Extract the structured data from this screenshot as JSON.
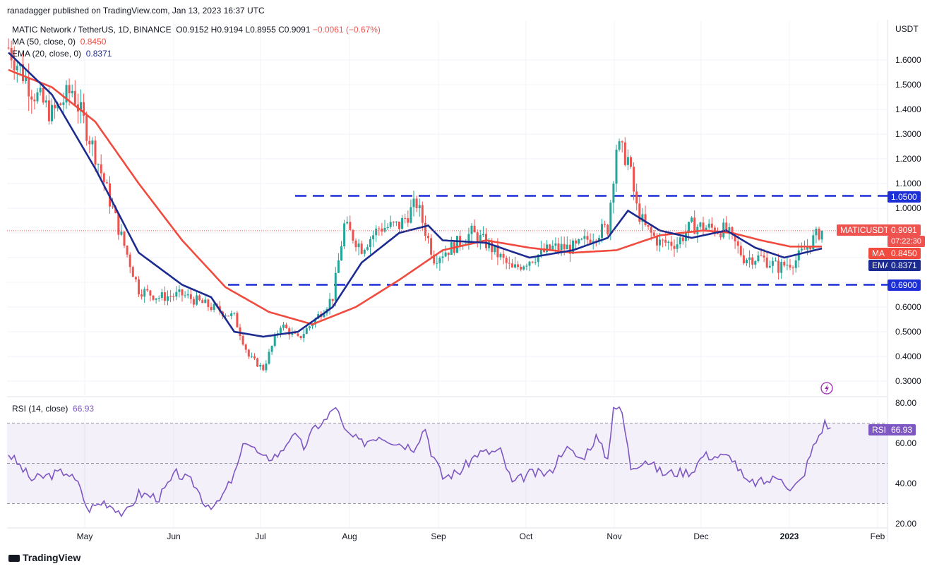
{
  "header": {
    "published_by": "ranadagger published on TradingView.com, Jan 13, 2023 16:37 UTC"
  },
  "legend": {
    "symbol": "MATIC Network / TetherUS, 1D, BINANCE",
    "o_label": "O",
    "o": "0.9152",
    "h_label": "H",
    "h": "0.9194",
    "l_label": "L",
    "l": "0.8955",
    "c_label": "C",
    "c": "0.9091",
    "change": "−0.0061 (−0.67%)",
    "ma_label": "MA (50, close, 0)",
    "ma_value": "0.8450",
    "ema_label": "EMA (20, close, 0)",
    "ema_value": "0.8371",
    "rsi_label": "RSI (14, close)",
    "rsi_value": "66.93"
  },
  "price_tags": {
    "resistance": "1.0500",
    "symbol_tag": "MATICUSDT",
    "last_price": "0.9091",
    "countdown": "07:22:30",
    "ma_tag": "MA",
    "ma_value": "0.8450",
    "ema_tag": "EMA",
    "ema_value": "0.8371",
    "support": "0.6900",
    "rsi_tag": "RSI",
    "rsi_value": "66.93"
  },
  "footer": {
    "brand": "TradingView"
  },
  "colors": {
    "candle_up": "#26a69a",
    "candle_down": "#ef5350",
    "ma": "#f04b3e",
    "ema": "#1c2b8f",
    "rsi": "#7e57c2",
    "hline": "#1c2fd6",
    "grid": "#f0f3fa"
  },
  "chart_data": [
    {
      "type": "candlestick",
      "currency": "USDT",
      "y_ticks": [
        "1.6000",
        "1.5000",
        "1.4000",
        "1.3000",
        "1.2000",
        "1.1000",
        "1.0000",
        "0.6000",
        "0.5000",
        "0.4000",
        "0.3000"
      ],
      "ylim": [
        0.27,
        1.72
      ],
      "x_tick_labels": [
        "May",
        "Jun",
        "Jul",
        "Aug",
        "Sep",
        "Oct",
        "Nov",
        "Dec",
        "2023",
        "Feb"
      ],
      "horizontal_levels": [
        1.05,
        0.69
      ],
      "anchors": [
        {
          "d": 0,
          "v": 1.65
        },
        {
          "d": 8,
          "v": 1.48
        },
        {
          "d": 15,
          "v": 1.38
        },
        {
          "d": 22,
          "v": 1.48
        },
        {
          "d": 30,
          "v": 1.22
        },
        {
          "d": 38,
          "v": 0.92
        },
        {
          "d": 45,
          "v": 0.67
        },
        {
          "d": 52,
          "v": 0.64
        },
        {
          "d": 60,
          "v": 0.65
        },
        {
          "d": 70,
          "v": 0.6
        },
        {
          "d": 78,
          "v": 0.56
        },
        {
          "d": 83,
          "v": 0.4
        },
        {
          "d": 88,
          "v": 0.35
        },
        {
          "d": 94,
          "v": 0.53
        },
        {
          "d": 100,
          "v": 0.47
        },
        {
          "d": 106,
          "v": 0.55
        },
        {
          "d": 112,
          "v": 0.64
        },
        {
          "d": 116,
          "v": 0.93
        },
        {
          "d": 122,
          "v": 0.84
        },
        {
          "d": 128,
          "v": 0.92
        },
        {
          "d": 135,
          "v": 0.93
        },
        {
          "d": 141,
          "v": 1.02
        },
        {
          "d": 147,
          "v": 0.8
        },
        {
          "d": 153,
          "v": 0.84
        },
        {
          "d": 160,
          "v": 0.9
        },
        {
          "d": 166,
          "v": 0.85
        },
        {
          "d": 174,
          "v": 0.75
        },
        {
          "d": 181,
          "v": 0.8
        },
        {
          "d": 188,
          "v": 0.84
        },
        {
          "d": 196,
          "v": 0.84
        },
        {
          "d": 203,
          "v": 0.9
        },
        {
          "d": 207,
          "v": 0.92
        },
        {
          "d": 210,
          "v": 1.25
        },
        {
          "d": 214,
          "v": 1.2
        },
        {
          "d": 217,
          "v": 1.0
        },
        {
          "d": 220,
          "v": 0.92
        },
        {
          "d": 225,
          "v": 0.86
        },
        {
          "d": 231,
          "v": 0.86
        },
        {
          "d": 236,
          "v": 0.93
        },
        {
          "d": 242,
          "v": 0.92
        },
        {
          "d": 248,
          "v": 0.91
        },
        {
          "d": 254,
          "v": 0.8
        },
        {
          "d": 260,
          "v": 0.8
        },
        {
          "d": 266,
          "v": 0.76
        },
        {
          "d": 272,
          "v": 0.79
        },
        {
          "d": 277,
          "v": 0.86
        },
        {
          "d": 281,
          "v": 0.915
        }
      ],
      "ma_anchors": [
        {
          "d": 0,
          "v": 1.56
        },
        {
          "d": 15,
          "v": 1.49
        },
        {
          "d": 30,
          "v": 1.35
        },
        {
          "d": 45,
          "v": 1.1
        },
        {
          "d": 60,
          "v": 0.87
        },
        {
          "d": 75,
          "v": 0.68
        },
        {
          "d": 90,
          "v": 0.58
        },
        {
          "d": 105,
          "v": 0.53
        },
        {
          "d": 120,
          "v": 0.6
        },
        {
          "d": 135,
          "v": 0.71
        },
        {
          "d": 150,
          "v": 0.83
        },
        {
          "d": 165,
          "v": 0.87
        },
        {
          "d": 180,
          "v": 0.84
        },
        {
          "d": 195,
          "v": 0.82
        },
        {
          "d": 210,
          "v": 0.83
        },
        {
          "d": 225,
          "v": 0.89
        },
        {
          "d": 240,
          "v": 0.91
        },
        {
          "d": 250,
          "v": 0.9
        },
        {
          "d": 260,
          "v": 0.87
        },
        {
          "d": 270,
          "v": 0.845
        },
        {
          "d": 281,
          "v": 0.845
        }
      ],
      "ema_anchors": [
        {
          "d": 0,
          "v": 1.63
        },
        {
          "d": 15,
          "v": 1.46
        },
        {
          "d": 30,
          "v": 1.16
        },
        {
          "d": 45,
          "v": 0.82
        },
        {
          "d": 60,
          "v": 0.69
        },
        {
          "d": 70,
          "v": 0.64
        },
        {
          "d": 78,
          "v": 0.5
        },
        {
          "d": 88,
          "v": 0.48
        },
        {
          "d": 100,
          "v": 0.5
        },
        {
          "d": 112,
          "v": 0.6
        },
        {
          "d": 122,
          "v": 0.78
        },
        {
          "d": 135,
          "v": 0.9
        },
        {
          "d": 145,
          "v": 0.93
        },
        {
          "d": 150,
          "v": 0.87
        },
        {
          "d": 165,
          "v": 0.86
        },
        {
          "d": 180,
          "v": 0.8
        },
        {
          "d": 195,
          "v": 0.83
        },
        {
          "d": 207,
          "v": 0.88
        },
        {
          "d": 214,
          "v": 0.99
        },
        {
          "d": 225,
          "v": 0.91
        },
        {
          "d": 236,
          "v": 0.88
        },
        {
          "d": 248,
          "v": 0.91
        },
        {
          "d": 258,
          "v": 0.84
        },
        {
          "d": 268,
          "v": 0.8
        },
        {
          "d": 281,
          "v": 0.837
        }
      ],
      "last_close": 0.9091
    },
    {
      "type": "line",
      "name": "RSI",
      "y_ticks": [
        "80.00",
        "60.00",
        "40.00",
        "20.00"
      ],
      "ylim": [
        19,
        81.5
      ],
      "band": [
        30,
        70
      ],
      "midline": 50,
      "anchors": [
        {
          "d": 0,
          "v": 55
        },
        {
          "d": 8,
          "v": 42
        },
        {
          "d": 20,
          "v": 46
        },
        {
          "d": 25,
          "v": 38
        },
        {
          "d": 27,
          "v": 27
        },
        {
          "d": 33,
          "v": 31
        },
        {
          "d": 37,
          "v": 28
        },
        {
          "d": 40,
          "v": 24
        },
        {
          "d": 45,
          "v": 35
        },
        {
          "d": 52,
          "v": 33
        },
        {
          "d": 58,
          "v": 45
        },
        {
          "d": 64,
          "v": 40
        },
        {
          "d": 68,
          "v": 30
        },
        {
          "d": 72,
          "v": 29
        },
        {
          "d": 78,
          "v": 44
        },
        {
          "d": 82,
          "v": 62
        },
        {
          "d": 88,
          "v": 52
        },
        {
          "d": 94,
          "v": 55
        },
        {
          "d": 98,
          "v": 65
        },
        {
          "d": 102,
          "v": 58
        },
        {
          "d": 106,
          "v": 68
        },
        {
          "d": 110,
          "v": 72
        },
        {
          "d": 113,
          "v": 79
        },
        {
          "d": 116,
          "v": 66
        },
        {
          "d": 122,
          "v": 60
        },
        {
          "d": 128,
          "v": 64
        },
        {
          "d": 135,
          "v": 60
        },
        {
          "d": 140,
          "v": 58
        },
        {
          "d": 144,
          "v": 68
        },
        {
          "d": 146,
          "v": 56
        },
        {
          "d": 150,
          "v": 43
        },
        {
          "d": 156,
          "v": 46
        },
        {
          "d": 162,
          "v": 55
        },
        {
          "d": 170,
          "v": 56
        },
        {
          "d": 174,
          "v": 40
        },
        {
          "d": 180,
          "v": 45
        },
        {
          "d": 187,
          "v": 45
        },
        {
          "d": 192,
          "v": 58
        },
        {
          "d": 198,
          "v": 52
        },
        {
          "d": 203,
          "v": 63
        },
        {
          "d": 207,
          "v": 52
        },
        {
          "d": 209,
          "v": 79
        },
        {
          "d": 212,
          "v": 75
        },
        {
          "d": 215,
          "v": 48
        },
        {
          "d": 220,
          "v": 52
        },
        {
          "d": 226,
          "v": 45
        },
        {
          "d": 236,
          "v": 46
        },
        {
          "d": 240,
          "v": 54
        },
        {
          "d": 250,
          "v": 53
        },
        {
          "d": 255,
          "v": 40
        },
        {
          "d": 262,
          "v": 41
        },
        {
          "d": 267,
          "v": 44
        },
        {
          "d": 270,
          "v": 36
        },
        {
          "d": 274,
          "v": 42
        },
        {
          "d": 278,
          "v": 58
        },
        {
          "d": 282,
          "v": 70
        },
        {
          "d": 284,
          "v": 67
        }
      ]
    }
  ]
}
